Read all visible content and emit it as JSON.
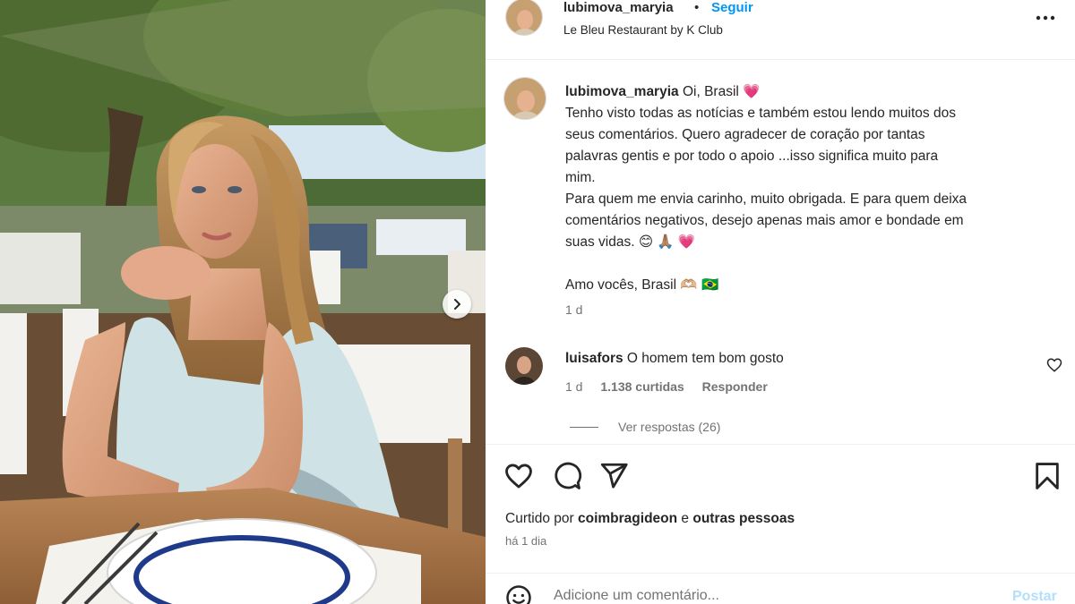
{
  "header": {
    "username": "lubimova_maryia",
    "separator": "•",
    "follow_label": "Seguir",
    "location": "Le Bleu Restaurant by K Club",
    "more_icon": "more-horizontal-icon"
  },
  "caption": {
    "username": "lubimova_maryia",
    "first_line": "Oi, Brasil",
    "heart_emoji": "💗",
    "lines": [
      "Tenho visto todas as notícias e também estou lendo muitos dos",
      "seus comentários. Quero agradecer de coração por tantas",
      "palavras gentis e por todo o apoio ...isso significa muito para",
      "mim.",
      "Para quem me envia carinho, muito obrigada. E para quem deixa",
      "comentários negativos, desejo apenas mais amor e bondade em",
      "suas vidas. 😊 🙏🏽 💗"
    ],
    "closing": "Amo vocês, Brasil 🫶🏼 🇧🇷",
    "time": "1 d"
  },
  "comment": {
    "username": "luisafors",
    "text": "O homem tem bom gosto",
    "time": "1 d",
    "likes": "1.138 curtidas",
    "reply_label": "Responder",
    "view_replies": "Ver respostas (26)"
  },
  "actions": {
    "like_icon": "heart-icon",
    "comment_icon": "comment-icon",
    "share_icon": "send-icon",
    "save_icon": "bookmark-icon"
  },
  "likes": {
    "prefix": "Curtido por",
    "user": "coimbragideon",
    "joiner": "e",
    "others": "outras pessoas"
  },
  "post_time": "há 1 dia",
  "add_comment": {
    "placeholder": "Adicione um comentário...",
    "post_label": "Postar"
  },
  "colors": {
    "accent": "#0095f6",
    "post_disabled": "#b2dffc",
    "text": "#262626",
    "muted": "#737373"
  }
}
